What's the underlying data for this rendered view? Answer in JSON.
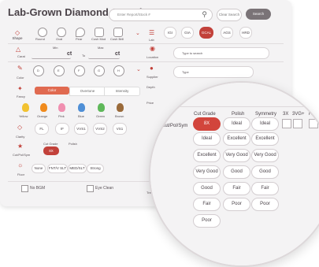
{
  "app": {
    "title": "Lab-Grown Diamond Search"
  },
  "search": {
    "placeholder": "Enter Report/Stock #",
    "clear_label": "Clear Search",
    "search_label": "Search"
  },
  "shape": {
    "label": "Shape",
    "items": [
      "Round",
      "Oval",
      "Pear",
      "Cush Mod",
      "Cush Brill"
    ]
  },
  "lab": {
    "label": "Lab",
    "items": [
      "IGI",
      "GIA",
      "GCAL",
      "AGS",
      "HRD"
    ],
    "selected": "GCAL"
  },
  "carat": {
    "label": "Carat",
    "min_label": "Min",
    "max_label": "Max",
    "unit": "ct",
    "to": "To"
  },
  "location": {
    "label": "Location",
    "placeholder": "Type to search"
  },
  "color": {
    "label": "Color",
    "items": [
      "D",
      "E",
      "F",
      "G",
      "H"
    ]
  },
  "supplier": {
    "label": "Supplier",
    "placeholder": "Type"
  },
  "fancy": {
    "label": "Fancy",
    "tabs": [
      "Color",
      "Overtone",
      "Intensity"
    ],
    "selected": "Color",
    "colors": [
      {
        "name": "Yellow",
        "hex": "#f2c230"
      },
      {
        "name": "Orange",
        "hex": "#f08a1c"
      },
      {
        "name": "Pink",
        "hex": "#f08fb0"
      },
      {
        "name": "Blue",
        "hex": "#4f8fd6"
      },
      {
        "name": "Green",
        "hex": "#5fb85a"
      },
      {
        "name": "Brown",
        "hex": "#9a6a3a"
      }
    ]
  },
  "clarity": {
    "label": "Clarity",
    "items": [
      "FL",
      "IF",
      "VVS1",
      "VVS2",
      "VS1"
    ]
  },
  "depth": {
    "label": "Depth"
  },
  "price": {
    "label": "Price"
  },
  "cutpolsym": {
    "label": "Cut/Pol/Sym",
    "cut_label": "Cut Grade",
    "polish_label": "Polish",
    "selected": "8X"
  },
  "fluor": {
    "label": "Fluor",
    "items": [
      "None",
      "FNT/V SLT",
      "MED/SLT",
      "Strong"
    ]
  },
  "treatment": {
    "label": "Treatment"
  },
  "checks": {
    "no_bgm": "No BGM",
    "eye_clean": "Eye Clean"
  },
  "lens": {
    "side_label": "Cut/Pol/Sym",
    "headers": {
      "cut": "Cut Grade",
      "polish": "Polish",
      "symmetry": "Symmetry",
      "c3x": "3X",
      "c3vg": "3VG+",
      "ha": "H&A"
    },
    "cut": [
      "8X",
      "Ideal",
      "Excellent",
      "Very Good",
      "Good",
      "Fair",
      "Poor"
    ],
    "polish": [
      "Ideal",
      "Excellent",
      "Very Good",
      "Good",
      "Fair",
      "Poor"
    ],
    "symmetry": [
      "Ideal",
      "Excellent",
      "Very Good",
      "Good",
      "Fair",
      "Poor"
    ]
  },
  "colors": {
    "accent": "#c2413a",
    "panel": "#f4f3f4",
    "button_grey": "#7a7377"
  }
}
